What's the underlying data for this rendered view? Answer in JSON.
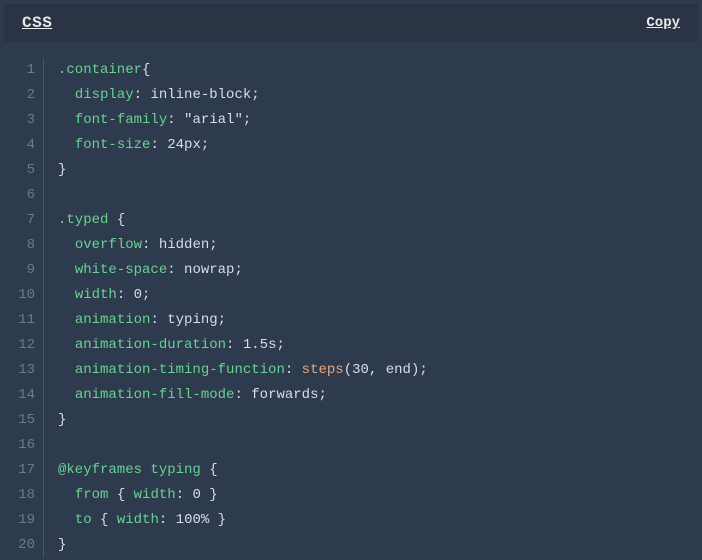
{
  "header": {
    "language": "CSS",
    "copy_label": "Copy"
  },
  "code": {
    "lines": [
      {
        "n": 1,
        "t": [
          [
            "sel",
            ".container"
          ],
          [
            "punc",
            "{"
          ]
        ]
      },
      {
        "n": 2,
        "t": [
          [
            "plain",
            "  "
          ],
          [
            "prop",
            "display"
          ],
          [
            "punc",
            ": "
          ],
          [
            "val",
            "inline-block"
          ],
          [
            "punc",
            ";"
          ]
        ]
      },
      {
        "n": 3,
        "t": [
          [
            "plain",
            "  "
          ],
          [
            "prop",
            "font-family"
          ],
          [
            "punc",
            ": "
          ],
          [
            "str",
            "\"arial\""
          ],
          [
            "punc",
            ";"
          ]
        ]
      },
      {
        "n": 4,
        "t": [
          [
            "plain",
            "  "
          ],
          [
            "prop",
            "font-size"
          ],
          [
            "punc",
            ": "
          ],
          [
            "num",
            "24px"
          ],
          [
            "punc",
            ";"
          ]
        ]
      },
      {
        "n": 5,
        "t": [
          [
            "punc",
            "}"
          ]
        ]
      },
      {
        "n": 6,
        "t": []
      },
      {
        "n": 7,
        "t": [
          [
            "sel",
            ".typed "
          ],
          [
            "punc",
            "{"
          ]
        ]
      },
      {
        "n": 8,
        "t": [
          [
            "plain",
            "  "
          ],
          [
            "prop",
            "overflow"
          ],
          [
            "punc",
            ": "
          ],
          [
            "val",
            "hidden"
          ],
          [
            "punc",
            ";"
          ]
        ]
      },
      {
        "n": 9,
        "t": [
          [
            "plain",
            "  "
          ],
          [
            "prop",
            "white-space"
          ],
          [
            "punc",
            ": "
          ],
          [
            "val",
            "nowrap"
          ],
          [
            "punc",
            ";"
          ]
        ]
      },
      {
        "n": 10,
        "t": [
          [
            "plain",
            "  "
          ],
          [
            "prop",
            "width"
          ],
          [
            "punc",
            ": "
          ],
          [
            "num",
            "0"
          ],
          [
            "punc",
            ";"
          ]
        ]
      },
      {
        "n": 11,
        "t": [
          [
            "plain",
            "  "
          ],
          [
            "prop",
            "animation"
          ],
          [
            "punc",
            ": "
          ],
          [
            "val",
            "typing"
          ],
          [
            "punc",
            ";"
          ]
        ]
      },
      {
        "n": 12,
        "t": [
          [
            "plain",
            "  "
          ],
          [
            "prop",
            "animation-duration"
          ],
          [
            "punc",
            ": "
          ],
          [
            "num",
            "1.5s"
          ],
          [
            "punc",
            ";"
          ]
        ]
      },
      {
        "n": 13,
        "t": [
          [
            "plain",
            "  "
          ],
          [
            "prop",
            "animation-timing-function"
          ],
          [
            "punc",
            ": "
          ],
          [
            "func",
            "steps"
          ],
          [
            "punc",
            "("
          ],
          [
            "num",
            "30"
          ],
          [
            "punc",
            ", "
          ],
          [
            "val",
            "end"
          ],
          [
            "punc",
            ");"
          ]
        ]
      },
      {
        "n": 14,
        "t": [
          [
            "plain",
            "  "
          ],
          [
            "prop",
            "animation-fill-mode"
          ],
          [
            "punc",
            ": "
          ],
          [
            "val",
            "forwards"
          ],
          [
            "punc",
            ";"
          ]
        ]
      },
      {
        "n": 15,
        "t": [
          [
            "punc",
            "}"
          ]
        ]
      },
      {
        "n": 16,
        "t": []
      },
      {
        "n": 17,
        "t": [
          [
            "kw",
            "@keyframes typing "
          ],
          [
            "punc",
            "{"
          ]
        ]
      },
      {
        "n": 18,
        "t": [
          [
            "plain",
            "  "
          ],
          [
            "kw",
            "from"
          ],
          [
            "punc",
            " { "
          ],
          [
            "prop",
            "width"
          ],
          [
            "punc",
            ": "
          ],
          [
            "num",
            "0"
          ],
          [
            "punc",
            " }"
          ]
        ]
      },
      {
        "n": 19,
        "t": [
          [
            "plain",
            "  "
          ],
          [
            "kw",
            "to"
          ],
          [
            "punc",
            " { "
          ],
          [
            "prop",
            "width"
          ],
          [
            "punc",
            ": "
          ],
          [
            "num",
            "100%"
          ],
          [
            "punc",
            " }"
          ]
        ]
      },
      {
        "n": 20,
        "t": [
          [
            "punc",
            "}"
          ]
        ]
      }
    ]
  }
}
